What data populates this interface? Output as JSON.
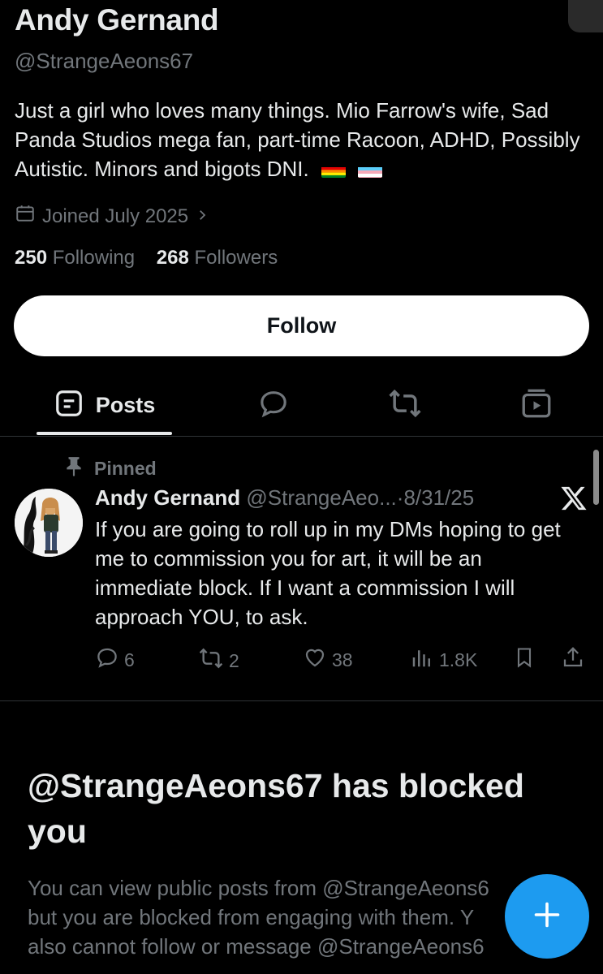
{
  "profile": {
    "name": "Andy Gernand",
    "handle": "@StrangeAeons67",
    "bio": "Just a girl who loves many things. Mio Farrow's wife, Sad Panda Studios mega fan, part-time Racoon, ADHD, Possibly Autistic. Minors and bigots DNI.",
    "bio_icons": [
      "rainbow-flag-icon",
      "trans-flag-icon"
    ],
    "joined": "Joined July 2025",
    "following_count": "250",
    "following_label": "Following",
    "followers_count": "268",
    "followers_label": "Followers"
  },
  "follow_button": {
    "label": "Follow"
  },
  "tabs": [
    {
      "label": "Posts",
      "icon": "posts-icon",
      "active": true
    },
    {
      "label": "",
      "icon": "replies-icon"
    },
    {
      "label": "",
      "icon": "reposts-icon"
    },
    {
      "label": "",
      "icon": "media-icon"
    }
  ],
  "pinned_post": {
    "pinned_label": "Pinned",
    "author": "Andy Gernand",
    "handle": "@StrangeAeo...",
    "separator": "·",
    "date": "8/31/25",
    "text": "If you are going to roll up in my DMs hoping to get me to commission you for art, it will be an immediate block. If I want a commission I will approach YOU, to ask.",
    "replies": "6",
    "reposts": "2",
    "likes": "38",
    "views": "1.8K"
  },
  "blocked": {
    "title": "@StrangeAeons67 has blocked you",
    "line1": "You can view public posts from @StrangeAeons6",
    "line2": "but you are blocked from engaging with them. Y",
    "line3": "also cannot follow or message @StrangeAeons6"
  },
  "colors": {
    "background": "#000000",
    "text": "#e7e9ea",
    "secondary": "#71767b",
    "accent": "#1d9bf0"
  }
}
